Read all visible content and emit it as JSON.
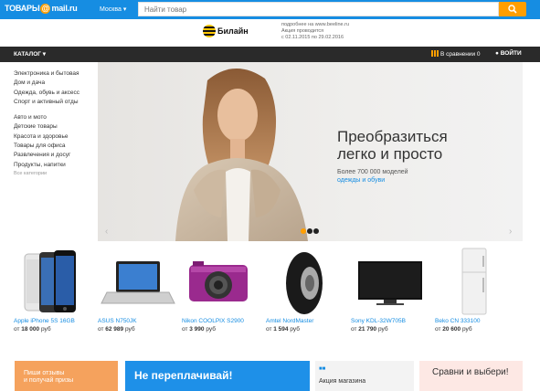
{
  "header": {
    "logo_prefix": "ТОВАРЫ",
    "logo_at": "@",
    "logo_suffix": "mail.ru",
    "city": "Москва ▾",
    "search_placeholder": "Найти товар",
    "accent": "#168de2",
    "search_button_color": "#ff9e00"
  },
  "promo": {
    "brand": "Билайн",
    "line1": "подробнее на www.beeline.ru",
    "line2": "Акция проводится",
    "line3": "с 02.11.2015 по 29.02.2016"
  },
  "catbar": {
    "catalog_label": "КАТАЛОГ ▾",
    "compare_label": "В сравнении 0",
    "login_label": "ВОЙТИ"
  },
  "sidebar": {
    "group1": [
      "Электроника и бытовая",
      "Дом и дача",
      "Одежда, обувь и аксесс",
      "Спорт и активный отды"
    ],
    "group2": [
      "Авто и мото",
      "Детские товары",
      "Красота и здоровье",
      "Товары для офиса",
      "Развлечения и досуг",
      "Продукты, напитки"
    ],
    "all_label": "Все категории"
  },
  "banner": {
    "title_line1": "Преобразиться",
    "title_line2": "легко и просто",
    "subtitle": "Более 700 000 моделей",
    "link": "одежды и обуви"
  },
  "products": [
    {
      "name": "Apple iPhone 5S 16GB",
      "price_prefix": "от",
      "price": "18 000",
      "currency": "руб",
      "icon": "smartphone-icon"
    },
    {
      "name": "ASUS N750JK",
      "price_prefix": "от",
      "price": "62 989",
      "currency": "руб",
      "icon": "laptop-icon"
    },
    {
      "name": "Nikon COOLPIX S2900",
      "price_prefix": "от",
      "price": "3 990",
      "currency": "руб",
      "icon": "camera-icon"
    },
    {
      "name": "Amtel NordMaster",
      "price_prefix": "от",
      "price": "1 594",
      "currency": "руб",
      "icon": "tire-icon"
    },
    {
      "name": "Sony KDL-32W705B",
      "price_prefix": "от",
      "price": "21 790",
      "currency": "руб",
      "icon": "tv-icon"
    },
    {
      "name": "Beko CN 333100",
      "price_prefix": "от",
      "price": "20 600",
      "currency": "руб",
      "icon": "fridge-icon"
    }
  ],
  "bottom": {
    "orange_line1": "Пиши отзывы",
    "orange_line2": "и получай призы",
    "blue_text": "Не переплачивай!",
    "grey_top": "",
    "grey_text": "Акция магазина",
    "pink_text": "Сравни и выбери!"
  }
}
